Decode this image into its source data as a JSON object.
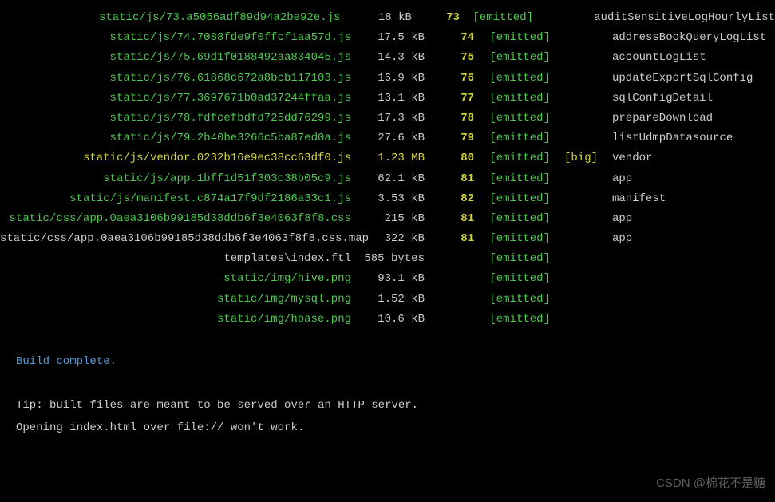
{
  "assets": [
    {
      "asset": "static/js/73.a5056adf89d94a2be92e.js",
      "size": "18 kB",
      "chunk": "73",
      "emitted": "[emitted]",
      "big": "",
      "name": "auditSensitiveLogHourlyList",
      "assetClass": ""
    },
    {
      "asset": "static/js/74.7088fde9f0ffcf1aa57d.js",
      "size": "17.5 kB",
      "chunk": "74",
      "emitted": "[emitted]",
      "big": "",
      "name": "addressBookQueryLogList",
      "assetClass": ""
    },
    {
      "asset": "static/js/75.69d1f0188492aa834045.js",
      "size": "14.3 kB",
      "chunk": "75",
      "emitted": "[emitted]",
      "big": "",
      "name": "accountLogList",
      "assetClass": ""
    },
    {
      "asset": "static/js/76.61868c672a8bcb117103.js",
      "size": "16.9 kB",
      "chunk": "76",
      "emitted": "[emitted]",
      "big": "",
      "name": "updateExportSqlConfig",
      "assetClass": ""
    },
    {
      "asset": "static/js/77.3697671b0ad37244ffaa.js",
      "size": "13.1 kB",
      "chunk": "77",
      "emitted": "[emitted]",
      "big": "",
      "name": "sqlConfigDetail",
      "assetClass": ""
    },
    {
      "asset": "static/js/78.fdfcefbdfd725dd76299.js",
      "size": "17.3 kB",
      "chunk": "78",
      "emitted": "[emitted]",
      "big": "",
      "name": "prepareDownload",
      "assetClass": ""
    },
    {
      "asset": "static/js/79.2b40be3266c5ba87ed0a.js",
      "size": "27.6 kB",
      "chunk": "79",
      "emitted": "[emitted]",
      "big": "",
      "name": "listUdmpDatasource",
      "assetClass": ""
    },
    {
      "asset": "static/js/vendor.0232b16e9ec38cc63df0.js",
      "size": "1.23 MB",
      "chunk": "80",
      "emitted": "[emitted]",
      "big": "[big]",
      "name": "vendor",
      "assetClass": "yellow",
      "sizeClass": "yellow"
    },
    {
      "asset": "static/js/app.1bff1d51f303c38b05c9.js",
      "size": "62.1 kB",
      "chunk": "81",
      "emitted": "[emitted]",
      "big": "",
      "name": "app",
      "assetClass": ""
    },
    {
      "asset": "static/js/manifest.c874a17f9df2186a33c1.js",
      "size": "3.53 kB",
      "chunk": "82",
      "emitted": "[emitted]",
      "big": "",
      "name": "manifest",
      "assetClass": ""
    },
    {
      "asset": "static/css/app.0aea3106b99185d38ddb6f3e4063f8f8.css",
      "size": "215 kB",
      "chunk": "81",
      "emitted": "[emitted]",
      "big": "",
      "name": "app",
      "assetClass": ""
    },
    {
      "asset": "static/css/app.0aea3106b99185d38ddb6f3e4063f8f8.css.map",
      "size": "322 kB",
      "chunk": "81",
      "emitted": "[emitted]",
      "big": "",
      "name": "app",
      "assetClass": "white"
    },
    {
      "asset": "templates\\index.ftl",
      "size": "585 bytes",
      "chunk": "",
      "emitted": "[emitted]",
      "big": "",
      "name": "",
      "assetClass": "white"
    },
    {
      "asset": "static/img/hive.png",
      "size": "93.1 kB",
      "chunk": "",
      "emitted": "[emitted]",
      "big": "",
      "name": "",
      "assetClass": ""
    },
    {
      "asset": "static/img/mysql.png",
      "size": "1.52 kB",
      "chunk": "",
      "emitted": "[emitted]",
      "big": "",
      "name": "",
      "assetClass": ""
    },
    {
      "asset": "static/img/hbase.png",
      "size": "10.6 kB",
      "chunk": "",
      "emitted": "[emitted]",
      "big": "",
      "name": "",
      "assetClass": ""
    }
  ],
  "footer": {
    "build_complete": "Build complete.",
    "tip_line1": "Tip: built files are meant to be served over an HTTP server.",
    "tip_line2": "Opening index.html over file:// won't work."
  },
  "watermark": "CSDN @棉花不是糖"
}
